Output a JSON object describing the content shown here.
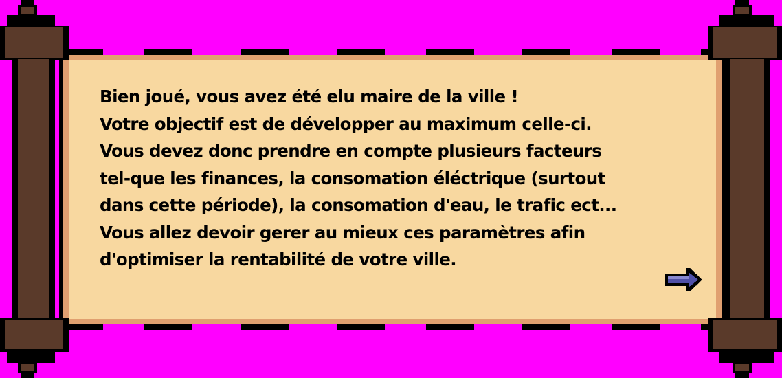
{
  "dialog": {
    "lines": [
      "Bien joué, vous avez été elu maire de la ville !",
      "Votre objectif est de développer au maximum celle-ci.",
      "Vous devez donc prendre en compte plusieurs facteurs",
      "tel-que les finances, la consomation éléctrique (surtout",
      "dans cette période), la consomation d'eau, le trafic ect...",
      "Vous allez devoir gerer au mieux ces paramètres afin",
      "d'optimiser la rentabilité de votre ville."
    ],
    "next_icon": "arrow-right-icon"
  },
  "colors": {
    "background": "#ff00ff",
    "parchment": "#f8d8a0",
    "parchment_edge": "#e0a070",
    "rod": "#5a3a2a",
    "outline": "#000000",
    "text": "#000000",
    "arrow_fill": "#5050a8",
    "arrow_highlight": "#8888d0"
  }
}
